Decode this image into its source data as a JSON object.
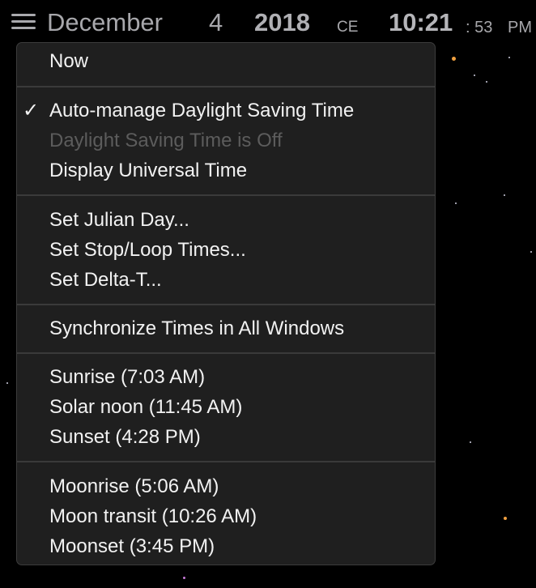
{
  "header": {
    "month": "December",
    "day": "4",
    "year": "2018",
    "era": "CE",
    "time": "10:21",
    "seconds": ": 53",
    "ampm": "PM"
  },
  "menu": {
    "now": "Now",
    "auto_dst": "Auto-manage Daylight Saving Time",
    "checkmark": "✓",
    "dst_status": "Daylight Saving Time is Off",
    "universal_time": "Display Universal Time",
    "julian_day": "Set Julian Day...",
    "stop_loop": "Set Stop/Loop Times...",
    "delta_t": "Set Delta-T...",
    "sync": "Synchronize Times in All Windows",
    "sunrise": "Sunrise (7:03 AM)",
    "solar_noon": "Solar noon (11:45 AM)",
    "sunset": "Sunset (4:28 PM)",
    "moonrise": "Moonrise (5:06 AM)",
    "moon_transit": "Moon transit (10:26 AM)",
    "moonset": "Moonset (3:45 PM)"
  }
}
